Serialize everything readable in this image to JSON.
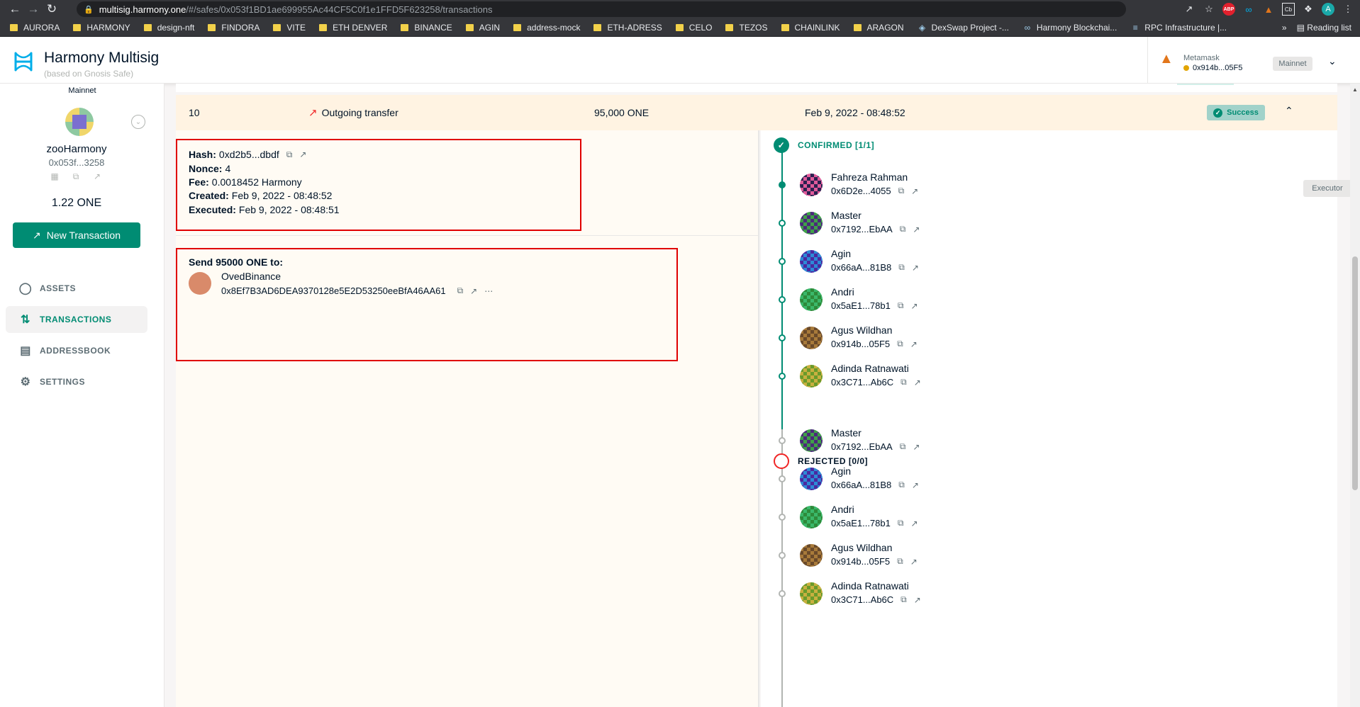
{
  "browser": {
    "url_host": "multisig.harmony.one",
    "url_path": "/#/safes/0x053f1BD1ae699955Ac44CF5C0f1e1FFD5F623258/transactions",
    "bookmarks": [
      {
        "label": "AURORA",
        "icon": "folder-icon"
      },
      {
        "label": "HARMONY",
        "icon": "folder-icon"
      },
      {
        "label": "design-nft",
        "icon": "folder-icon"
      },
      {
        "label": "FINDORA",
        "icon": "folder-icon"
      },
      {
        "label": "VITE",
        "icon": "folder-icon"
      },
      {
        "label": "ETH DENVER",
        "icon": "folder-icon"
      },
      {
        "label": "BINANCE",
        "icon": "folder-icon"
      },
      {
        "label": "AGIN",
        "icon": "folder-icon"
      },
      {
        "label": "address-mock",
        "icon": "folder-icon"
      },
      {
        "label": "ETH-ADRESS",
        "icon": "folder-icon"
      },
      {
        "label": "CELO",
        "icon": "folder-icon"
      },
      {
        "label": "TEZOS",
        "icon": "folder-icon"
      },
      {
        "label": "CHAINLINK",
        "icon": "folder-icon"
      },
      {
        "label": "ARAGON",
        "icon": "folder-icon"
      },
      {
        "label": "DexSwap Project -...",
        "icon": "dexswap-icon"
      },
      {
        "label": "Harmony Blockchai...",
        "icon": "harmony-icon"
      },
      {
        "label": "RPC Infrastructure |...",
        "icon": "solana-icon"
      }
    ],
    "more": "»",
    "reading_list": "Reading list"
  },
  "header": {
    "title": "Harmony Multisig",
    "subtitle": "(based on Gnosis Safe)",
    "provider_name": "Metamask",
    "provider_address": "0x914b...05F5",
    "network": "Mainnet"
  },
  "sidebar": {
    "network": "Mainnet",
    "safe_name": "zooHarmony",
    "safe_address": "0x053f...3258",
    "balance": "1.22 ONE",
    "new_tx": "New Transaction",
    "nav": [
      {
        "label": "ASSETS",
        "icon": "assets-icon"
      },
      {
        "label": "TRANSACTIONS",
        "icon": "transactions-icon"
      },
      {
        "label": "ADDRESSBOOK",
        "icon": "addressbook-icon"
      },
      {
        "label": "SETTINGS",
        "icon": "settings-icon"
      }
    ]
  },
  "tx": {
    "nonce": "10",
    "type": "Outgoing transfer",
    "amount": "95,000 ONE",
    "date": "Feb 9, 2022 - 08:48:52",
    "status": "Success",
    "status_color": "#008c73",
    "info": {
      "hash_label": "Hash:",
      "hash": "0xd2b5...dbdf",
      "nonce_label": "Nonce:",
      "nonce": "4",
      "fee_label": "Fee:",
      "fee": "0.0018452 Harmony",
      "created_label": "Created:",
      "created": "Feb 9, 2022 - 08:48:52",
      "executed_label": "Executed:",
      "executed": "Feb 9, 2022 - 08:48:51"
    },
    "send": {
      "title": "Send 95000 ONE to:",
      "recipient_name": "OvedBinance",
      "recipient_address": "0x8Ef7B3AD6DEA9370128e5E2D53250eeBfA46AA61"
    },
    "confirmed_label": "CONFIRMED [1/1]",
    "rejected_label": "REJECTED [0/0]",
    "executor_label": "Executor",
    "confirmed": [
      {
        "name": "Fahreza Rahman",
        "address": "0x6D2e...4055"
      },
      {
        "name": "Master",
        "address": "0x7192...EbAA"
      },
      {
        "name": "Agin",
        "address": "0x66aA...81B8"
      },
      {
        "name": "Andri",
        "address": "0x5aE1...78b1"
      },
      {
        "name": "Agus Wildhan",
        "address": "0x914b...05F5"
      },
      {
        "name": "Adinda Ratnawati",
        "address": "0x3C71...Ab6C"
      }
    ],
    "rejected": [
      {
        "name": "Master",
        "address": "0x7192...EbAA"
      },
      {
        "name": "Agin",
        "address": "0x66aA...81B8"
      },
      {
        "name": "Andri",
        "address": "0x5aE1...78b1"
      },
      {
        "name": "Agus Wildhan",
        "address": "0x914b...05F5"
      },
      {
        "name": "Adinda Ratnawati",
        "address": "0x3C71...Ab6C"
      }
    ]
  }
}
